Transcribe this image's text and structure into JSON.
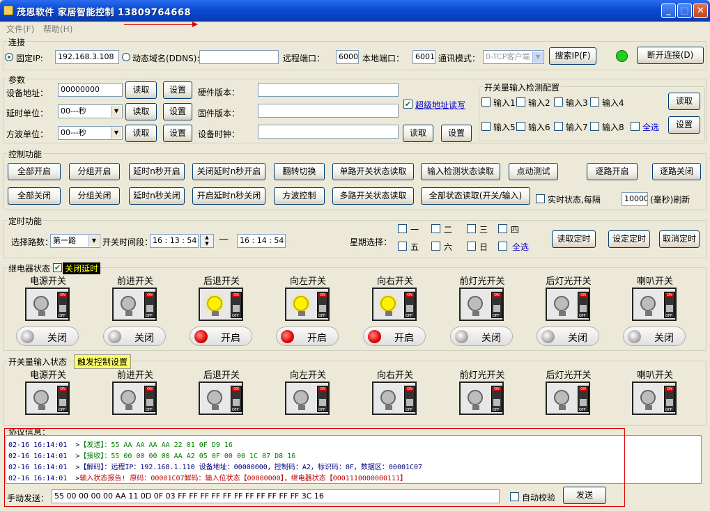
{
  "window": {
    "title": "茂思软件  家居智能控制  13809764668",
    "min": "_",
    "max": "□",
    "close": "✕"
  },
  "menu": {
    "file": "文件(F)",
    "help": "帮助(H)"
  },
  "conn": {
    "group": "连接",
    "fixed_ip_label": "固定IP:",
    "fixed_ip": "192.168.3.108",
    "ddns_label": "动态域名(DDNS):",
    "ddns": "",
    "remote_port_label": "远程端口：",
    "remote_port": "6000",
    "local_port_label": "本地端口：",
    "local_port": "6001",
    "mode_label": "通讯模式：",
    "mode": "0-TCP客户端",
    "search_btn": "搜索IP(F)",
    "disconnect_btn": "断开连接(D)",
    "status_color": "#1fd01f"
  },
  "params": {
    "group": "参数",
    "addr_label": "设备地址：",
    "addr": "00000000",
    "read": "读取",
    "set": "设置",
    "hw_label": "硬件版本：",
    "hw": "",
    "delay_label": "延时单位：",
    "delay": "00---秒",
    "fw_label": "固件版本：",
    "fw": "",
    "wave_label": "方波单位：",
    "wave": "00---秒",
    "clock_label": "设备时钟：",
    "clock": "",
    "super_label": "超级地址读写",
    "super_checked": "✔"
  },
  "inputcfg": {
    "group": "开关量输入检测配置",
    "items": [
      "输入1",
      "输入2",
      "输入3",
      "输入4",
      "输入5",
      "输入6",
      "输入7",
      "输入8"
    ],
    "select_all": "全选",
    "read": "读取",
    "set": "设置"
  },
  "control": {
    "group": "控制功能",
    "row1": [
      "全部开启",
      "分组开启",
      "延时n秒开启",
      "关闭延时n秒开启",
      "翻转切换",
      "单路开关状态读取",
      "输入检测状态读取",
      "点动测试",
      "逐路开启",
      "逐路关闭"
    ],
    "row2": [
      "全部关闭",
      "分组关闭",
      "延时n秒关闭",
      "开启延时n秒关闭",
      "方波控制",
      "多路开关状态读取",
      "全部状态读取(开关/输入)"
    ],
    "realtime_label": "实时状态,每隔",
    "interval": "10000",
    "interval_unit": "(毫秒)刷新"
  },
  "timer": {
    "group": "定时功能",
    "route_label": "选择路数：",
    "route": "第一路",
    "time_label": "开关时间段：",
    "start": "16 : 13 : 54",
    "dash": "—",
    "end": "16 : 14 : 54",
    "week_label": "星期选择：",
    "days": [
      "一",
      "二",
      "三",
      "四",
      "五",
      "六",
      "日"
    ],
    "all": "全选",
    "read": "读取定时",
    "set": "设定定时",
    "cancel": "取消定时"
  },
  "relay": {
    "group": "继电器状态",
    "delay_close": "关闭延时",
    "delay_checked": "✔",
    "devices": [
      {
        "name": "电源开关",
        "on": false,
        "state": "关闭"
      },
      {
        "name": "前进开关",
        "on": false,
        "state": "关闭"
      },
      {
        "name": "后退开关",
        "on": true,
        "state": "开启"
      },
      {
        "name": "向左开关",
        "on": true,
        "state": "开启"
      },
      {
        "name": "向右开关",
        "on": true,
        "state": "开启"
      },
      {
        "name": "前灯光开关",
        "on": false,
        "state": "关闭"
      },
      {
        "name": "后灯光开关",
        "on": false,
        "state": "关闭"
      },
      {
        "name": "喇叭开关",
        "on": false,
        "state": "关闭"
      }
    ]
  },
  "inputs": {
    "group": "开关量输入状态",
    "trigger": "触发控制设置",
    "devices": [
      "电源开关",
      "前进开关",
      "后退开关",
      "向左开关",
      "向右开关",
      "前灯光开关",
      "后灯光开关",
      "喇叭开关"
    ]
  },
  "protocol": {
    "group": "协议信息：",
    "lines": [
      {
        "time": "02-16 16:14:01",
        "arrow": ">",
        "tag": "【发送】",
        "text": "：55 AA AA AA AA 22 01 0F D9 16",
        "color": "#008000"
      },
      {
        "time": "02-16 16:14:01",
        "arrow": ">",
        "tag": "【接收】",
        "text": "：55 00 00 00 00 AA A2 05 0F 00 00 1C 07 D8 16",
        "color": "#008000"
      },
      {
        "time": "02-16 16:14:01",
        "arrow": ">",
        "tag": "【解码】",
        "text": "：远程IP：192.168.1.110  设备地址：00000000，控制码：A2，标识码：0F，数据区：00001C07",
        "color": "#000080"
      },
      {
        "time": "02-16 16:14:01",
        "arrow": ">",
        "tag": "",
        "text": "输入状态报告! 原码：00001C07解码：输入位状态【00000000】，继电器状态【0001110000000111】",
        "color": "#c00000"
      }
    ],
    "manual_label": "手动发送：",
    "manual": "55 00 00 00 00 AA 11 0D 0F 03 FF FF FF FF FF FF FF FF FF FF FF 3C 16",
    "auto_check": "自动校验",
    "send": "发送"
  }
}
